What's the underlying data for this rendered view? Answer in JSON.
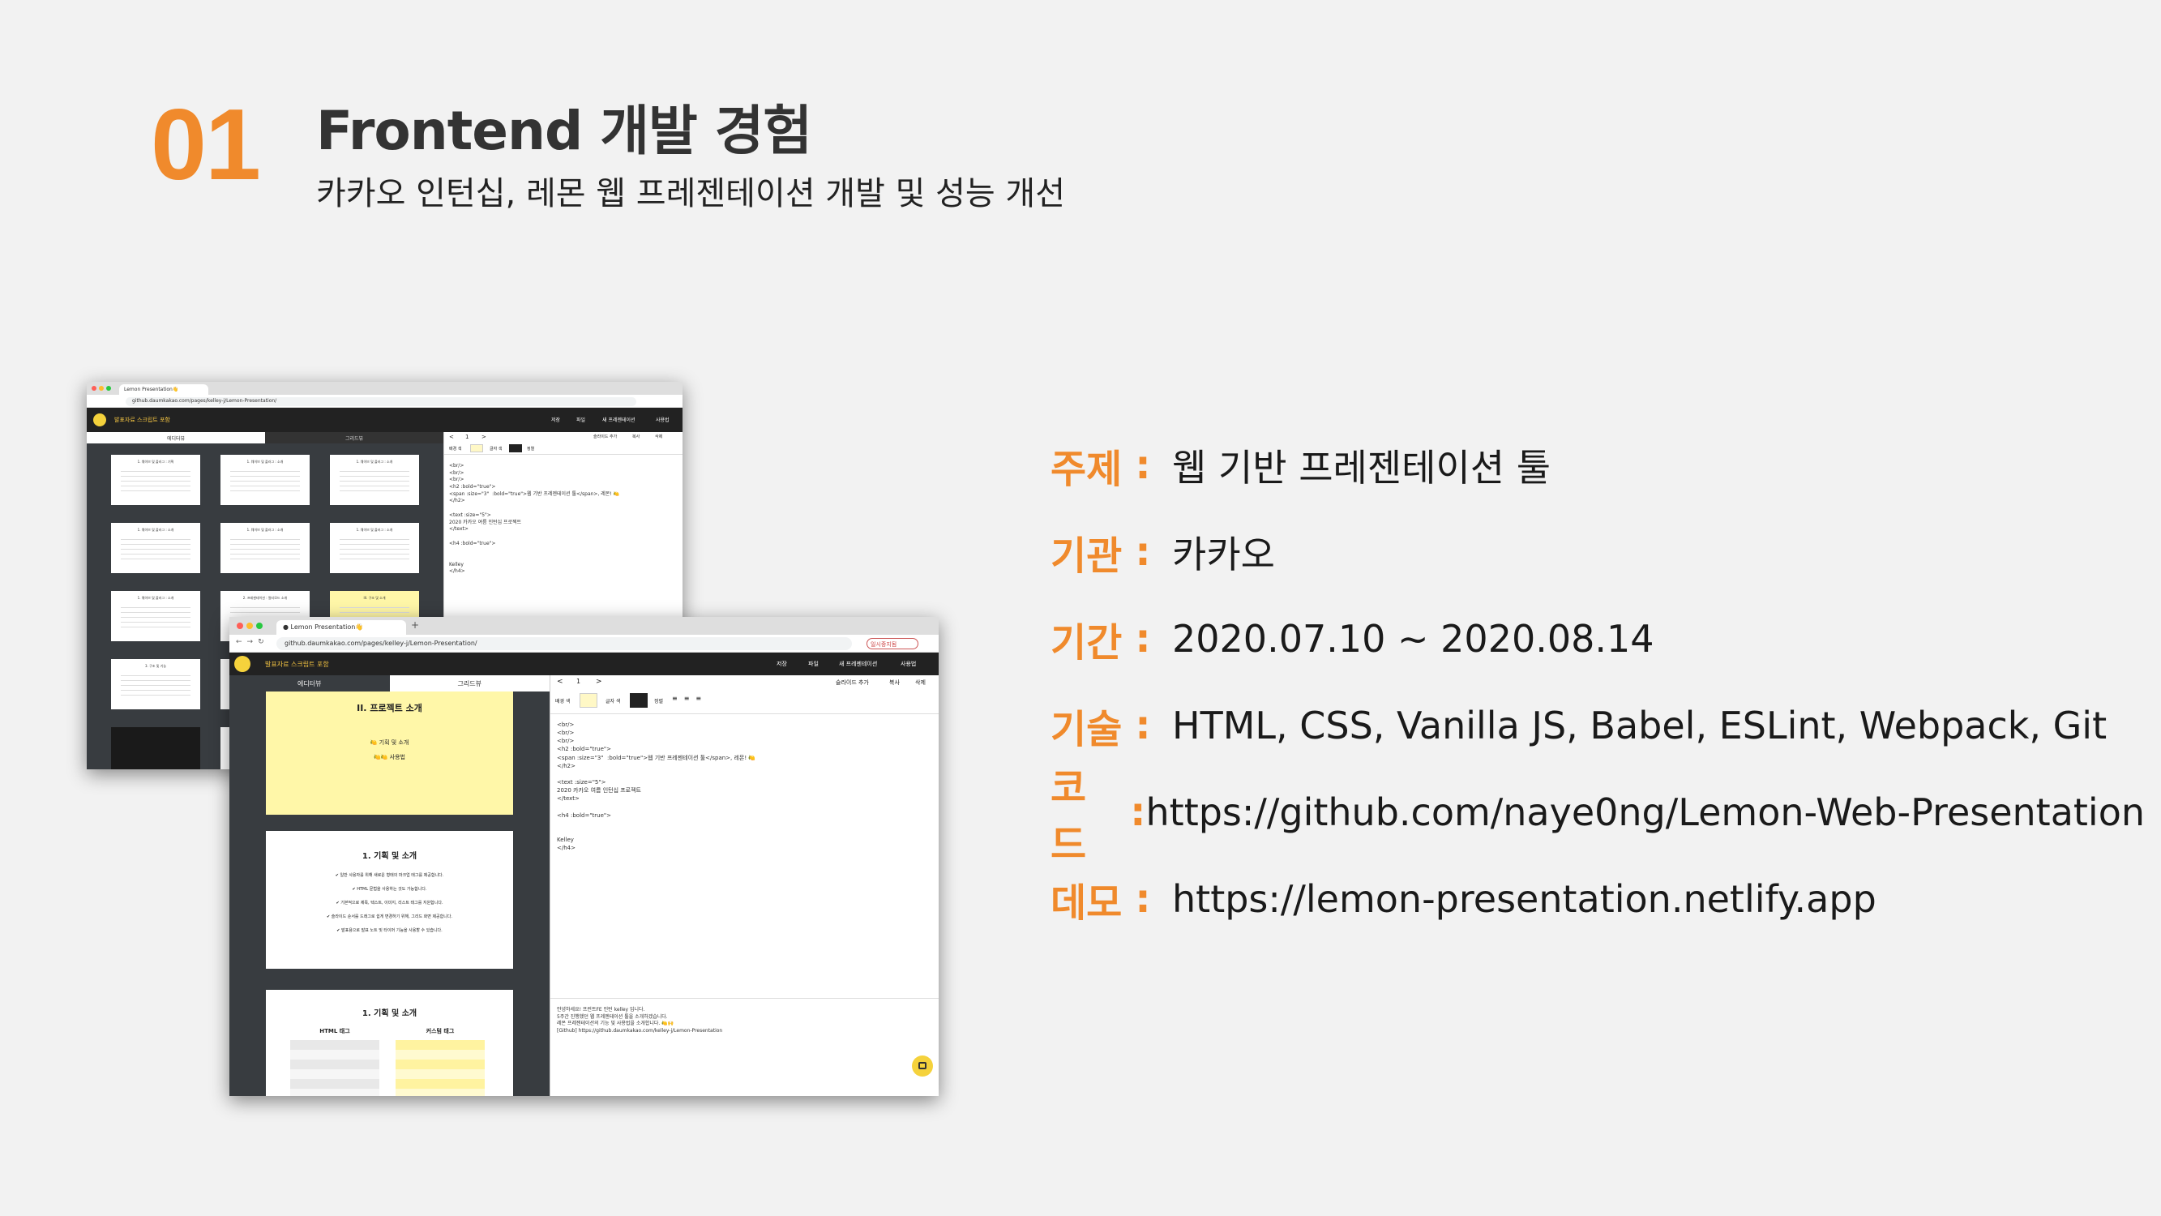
{
  "header": {
    "number": "01",
    "title": "Frontend 개발 경험",
    "subtitle": "카카오 인턴십, 레몬 웹 프레젠테이션 개발 및 성능 개선"
  },
  "info": [
    {
      "key": "주제",
      "value": "웹 기반 프레젠테이션 툴"
    },
    {
      "key": "기관",
      "value": "카카오"
    },
    {
      "key": "기간",
      "value": "2020.07.10 ~ 2020.08.14"
    },
    {
      "key": "기술",
      "value": "HTML, CSS, Vanilla JS, Babel, ESLint, Webpack, Git"
    },
    {
      "key": "코드",
      "value": "https://github.com/naye0ng/Lemon-Web-Presentation"
    },
    {
      "key": "데모",
      "value": "https://lemon-presentation.netlify.app"
    }
  ],
  "colon": ":",
  "browser": {
    "tab_title": "Lemon Presentation👋",
    "url": "github.daumkakao.com/pages/kelley-j/Lemon-Presentation/",
    "profile_label": "일시중지됨",
    "app_title": "발표자료 스크립트 포함",
    "menu": [
      "저장",
      "파일",
      "새 프레젠테이션",
      "사용법"
    ],
    "view_toggle": [
      "에디터뷰",
      "그리드뷰"
    ],
    "page_nav": [
      "<",
      "1",
      ">"
    ],
    "slide_actions": [
      "슬라이드 추가",
      "복사",
      "삭제"
    ],
    "color_labels": [
      "배경 색",
      "글자 색",
      "정렬"
    ],
    "code_lines": "<br/>\n<br/>\n<br/>\n<h2 :bold=\"true\">\n<span :size=\"3\"  :bold=\"true\">웹 기반 프레젠테이션 툴</span>, 레몬! 🍋\n</h2>\n\n<text :size=\"5\">\n2020 카카오 여름 인턴십 프로젝트\n</text>\n\n<h4 :bold=\"true\">\n\n\nKelley\n</h4>",
    "script_lines": "안녕하세요! 프런트FE 인턴 kelley 입니다.\n5주간 진행했던 웹 프레젠테이션 툴을 소개하겠습니다.\n레몬 프레젠테이션의 기능 및 사용법을 소개합니다. 🍋🙌\n[Github] https://github.daumkakao.com/kelley-j/Lemon-Presentation",
    "slides": [
      {
        "title": "II. 프로젝트 소개",
        "lines": [
          "🍋 기획 및 소개",
          "🍋🍋 사용법"
        ]
      },
      {
        "title": "1. 기획 및 소개",
        "lines": [
          "✔ 일반 사용자를 위해 새로운 형태의 마크업 태그를 제공합니다.",
          "✔ HTML 문법을 사용하는 것도 가능합니다.",
          "✔ 기본적으로 제목, 텍스트, 이미지, 리스트 태그를 지원합니다.",
          "✔ 슬라이드 순서를 드래그로 쉽게 변경하기 위해, 그리드 화면 제공합니다.",
          "✔ 발표용으로 발표 노트 및 타이머 기능을 사용할 수 있습니다."
        ]
      },
      {
        "title": "1. 기획 및 소개",
        "lines": [
          "HTML 태그",
          "커스텀 태그"
        ]
      }
    ],
    "back_slide_grid_titles": [
      "1. 웨이브 및 플러그 : 기획",
      "1. 웨이브 및 플러그 : 소개",
      "1. 웨이브 및 플러그 : 소개",
      "1. 웨이브 및 플러그 : 소개",
      "1. 웨이브 및 플러그 : 소개",
      "1. 웨이브 및 플러그 : 소개",
      "1. 웨이브 및 플러그 : 소개",
      "2. 프레젠테이션 : 멀티모드 소개",
      "III. 구조 및 소개",
      "3. 구조 및 기능",
      "",
      ""
    ]
  },
  "colors": {
    "accent": "#f08a2c",
    "lemon": "#f5d23c",
    "sidebar": "#383c40"
  }
}
